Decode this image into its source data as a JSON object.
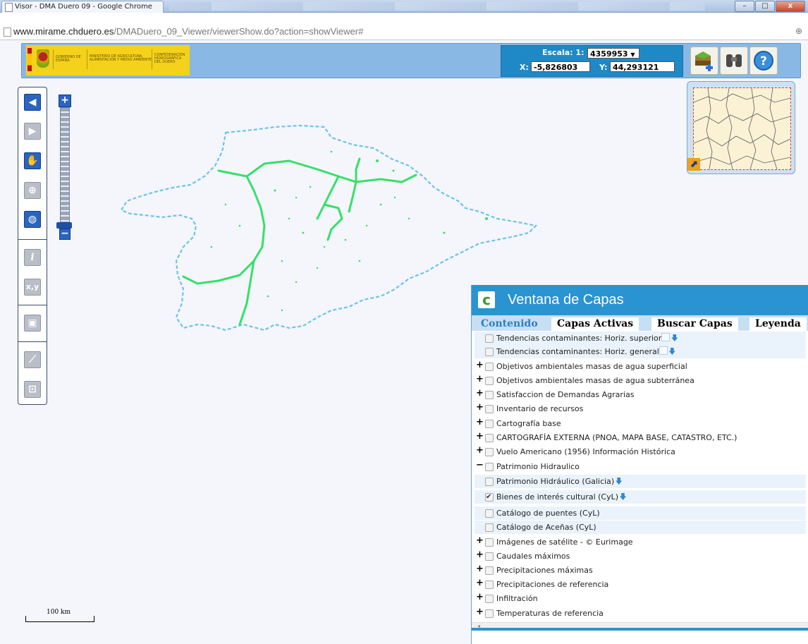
{
  "browser": {
    "tab_title": "Visor - DMA Duero 09 - Google Chrome",
    "url_host": "www.mirame.chduero.es",
    "url_path": "/DMADuero_09_Viewer/viewerShow.do?action=showViewer#",
    "zoom_icon": "⊕",
    "window_buttons": [
      "–",
      "□",
      "x"
    ]
  },
  "header": {
    "gov_line1": "GOBIERNO DE ESPAÑA",
    "gov_line2": "MINISTERIO DE AGRICULTURA, ALIMENTACIÓN Y MEDIO AMBIENTE",
    "gov_line3": "CONFEDERACIÓN HIDROGRÁFICA DEL DUERO",
    "scale_label": "Escala: 1:",
    "scale_value": "4359953",
    "x_label": "X:",
    "x_value": "-5,826803",
    "y_label": "Y:",
    "y_value": "44,293121"
  },
  "toolbar": {
    "icons": [
      "back-arrow-icon",
      "forward-arrow-icon",
      "hand-pan-icon",
      "zoom-box-icon",
      "globe-icon",
      "info-icon",
      "xy-coordinates-icon",
      "save-icon",
      "measure-icon",
      "crop-icon"
    ],
    "xy_text": "x,y",
    "info_text": "i",
    "zoom_in": "+",
    "zoom_out": "−"
  },
  "map": {
    "scale_text": "100 km",
    "outline_color": "#6fc3e8",
    "river_color": "#35e06a"
  },
  "layers_window": {
    "title": "Ventana de Capas",
    "tabs": [
      "Contenido",
      "Capas Activas",
      "Buscar Capas",
      "Leyenda"
    ],
    "rows": [
      {
        "label": "Tendencias contaminantes: Horiz. superior",
        "type": "sub",
        "checked": false
      },
      {
        "label": "Tendencias contaminantes: Horiz. general",
        "type": "sub",
        "checked": false
      },
      {
        "label": "Objetivos ambientales masas de agua superficial",
        "type": "group",
        "sign": "+",
        "checked": false
      },
      {
        "label": "Objetivos ambientales masas de agua subterránea",
        "type": "group",
        "sign": "+",
        "checked": false
      },
      {
        "label": "Satisfaccion de Demandas Agrarias",
        "type": "group",
        "sign": "+",
        "checked": false
      },
      {
        "label": "Inventario de recursos",
        "type": "group",
        "sign": "+",
        "checked": false
      },
      {
        "label": "Cartografía base",
        "type": "group",
        "sign": "+",
        "checked": false
      },
      {
        "label": "CARTOGRAFÍA EXTERNA (PNOA, MAPA BASE, CATASTRO, ETC.)",
        "type": "group",
        "sign": "+",
        "checked": false
      },
      {
        "label": "Vuelo Americano (1956) Información Histórica",
        "type": "group",
        "sign": "+",
        "checked": false
      },
      {
        "label": "Patrimonio Hidraulico",
        "type": "group",
        "sign": "−",
        "checked": false
      },
      {
        "label": "Patrimonio Hidráulico (Galicia)",
        "type": "sub",
        "checked": false
      },
      {
        "label": "Bienes de interés cultural (CyL)",
        "type": "sub",
        "checked": true
      },
      {
        "label": "Catálogo de puentes (CyL)",
        "type": "sub",
        "checked": false
      },
      {
        "label": "Catálogo de Aceñas (CyL)",
        "type": "sub",
        "checked": false
      },
      {
        "label": "Imágenes de satélite - © Eurimage",
        "type": "group",
        "sign": "+",
        "checked": false
      },
      {
        "label": "Caudales máximos",
        "type": "group",
        "sign": "+",
        "checked": false
      },
      {
        "label": "Precipitaciones máximas",
        "type": "group",
        "sign": "+",
        "checked": false
      },
      {
        "label": "Precipitaciones de referencia",
        "type": "group",
        "sign": "+",
        "checked": false
      },
      {
        "label": "Infiltración",
        "type": "group",
        "sign": "+",
        "checked": false
      },
      {
        "label": "Temperaturas de referencia",
        "type": "group",
        "sign": "+",
        "checked": false
      }
    ],
    "scroll_arrow": "◂"
  }
}
